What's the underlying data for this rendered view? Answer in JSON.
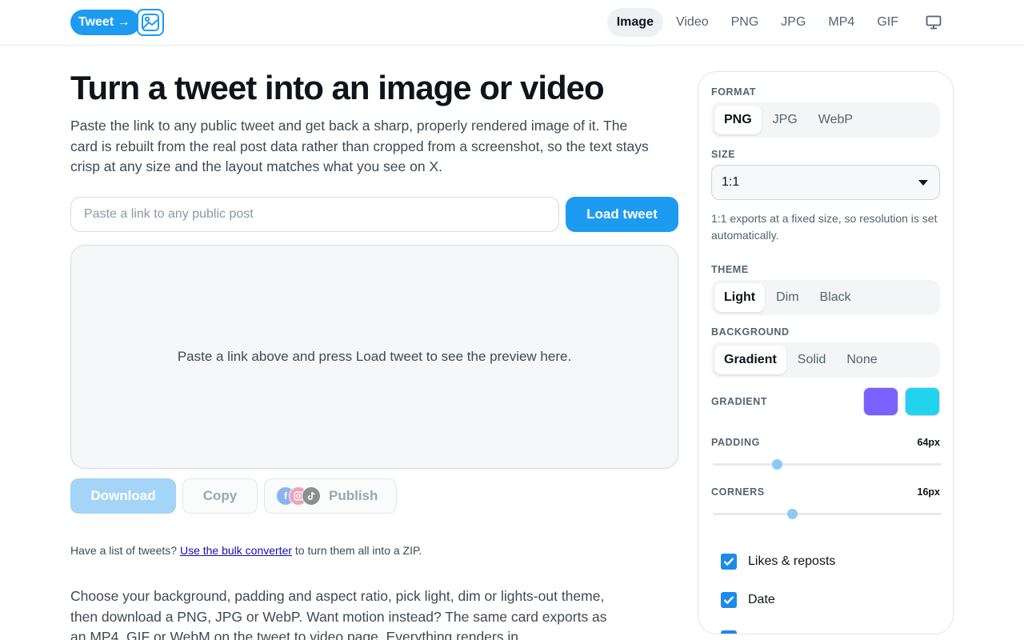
{
  "header": {
    "logo_text": "Tweet →",
    "nav": [
      {
        "label": "Image",
        "active": true
      },
      {
        "label": "Video",
        "active": false
      },
      {
        "label": "PNG",
        "active": false
      },
      {
        "label": "JPG",
        "active": false
      },
      {
        "label": "MP4",
        "active": false
      },
      {
        "label": "GIF",
        "active": false
      }
    ],
    "display_icon": "monitor-icon"
  },
  "main": {
    "title": "Turn a tweet into an image or video",
    "lead": "Paste the link to any public tweet and get back a sharp, properly rendered image of it. The card is rebuilt from the real post data rather than cropped from a screenshot, so the text stays crisp at any size and the layout matches what you see on X.",
    "url_input": {
      "value": "",
      "placeholder": "Paste a link to any public post"
    },
    "load_button": "Load tweet",
    "preview_placeholder": "Paste a link above and press Load tweet to see the preview here.",
    "download_button": "Download",
    "copy_button": "Copy",
    "publish_button": "Publish",
    "bulk": {
      "prefix": "Have a list of tweets?",
      "link": "Use the bulk converter",
      "suffix": "to turn them all into a ZIP."
    },
    "body": "Choose your background, padding and aspect ratio, pick light, dim or lights-out theme, then download a PNG, JPG or WebP. Want motion instead? The same card exports as an MP4, GIF or WebM on the tweet to video page. Everything renders in"
  },
  "panel": {
    "format": {
      "label": "FORMAT",
      "options": [
        "PNG",
        "JPG",
        "WebP"
      ],
      "selected": "PNG"
    },
    "size": {
      "label": "SIZE",
      "value": "1:1",
      "hint": "1:1 exports at a fixed size, so resolution is set automatically."
    },
    "theme": {
      "label": "THEME",
      "options": [
        "Light",
        "Dim",
        "Black"
      ],
      "selected": "Light"
    },
    "background": {
      "label": "BACKGROUND",
      "options": [
        "Gradient",
        "Solid",
        "None"
      ],
      "selected": "Gradient"
    },
    "gradient": {
      "label": "GRADIENT",
      "color_start": "#7b61ff",
      "color_end": "#22d3ee"
    },
    "padding": {
      "label": "PADDING",
      "value_text": "64px",
      "fraction": 0.28
    },
    "corners": {
      "label": "CORNERS",
      "value_text": "16px",
      "fraction": 0.345
    },
    "checkboxes": [
      {
        "label": "Likes & reposts",
        "checked": true
      },
      {
        "label": "Date",
        "checked": true
      }
    ]
  },
  "colors": {
    "accent": "#1d9bf0",
    "download_disabled": "#a4d4f7"
  }
}
